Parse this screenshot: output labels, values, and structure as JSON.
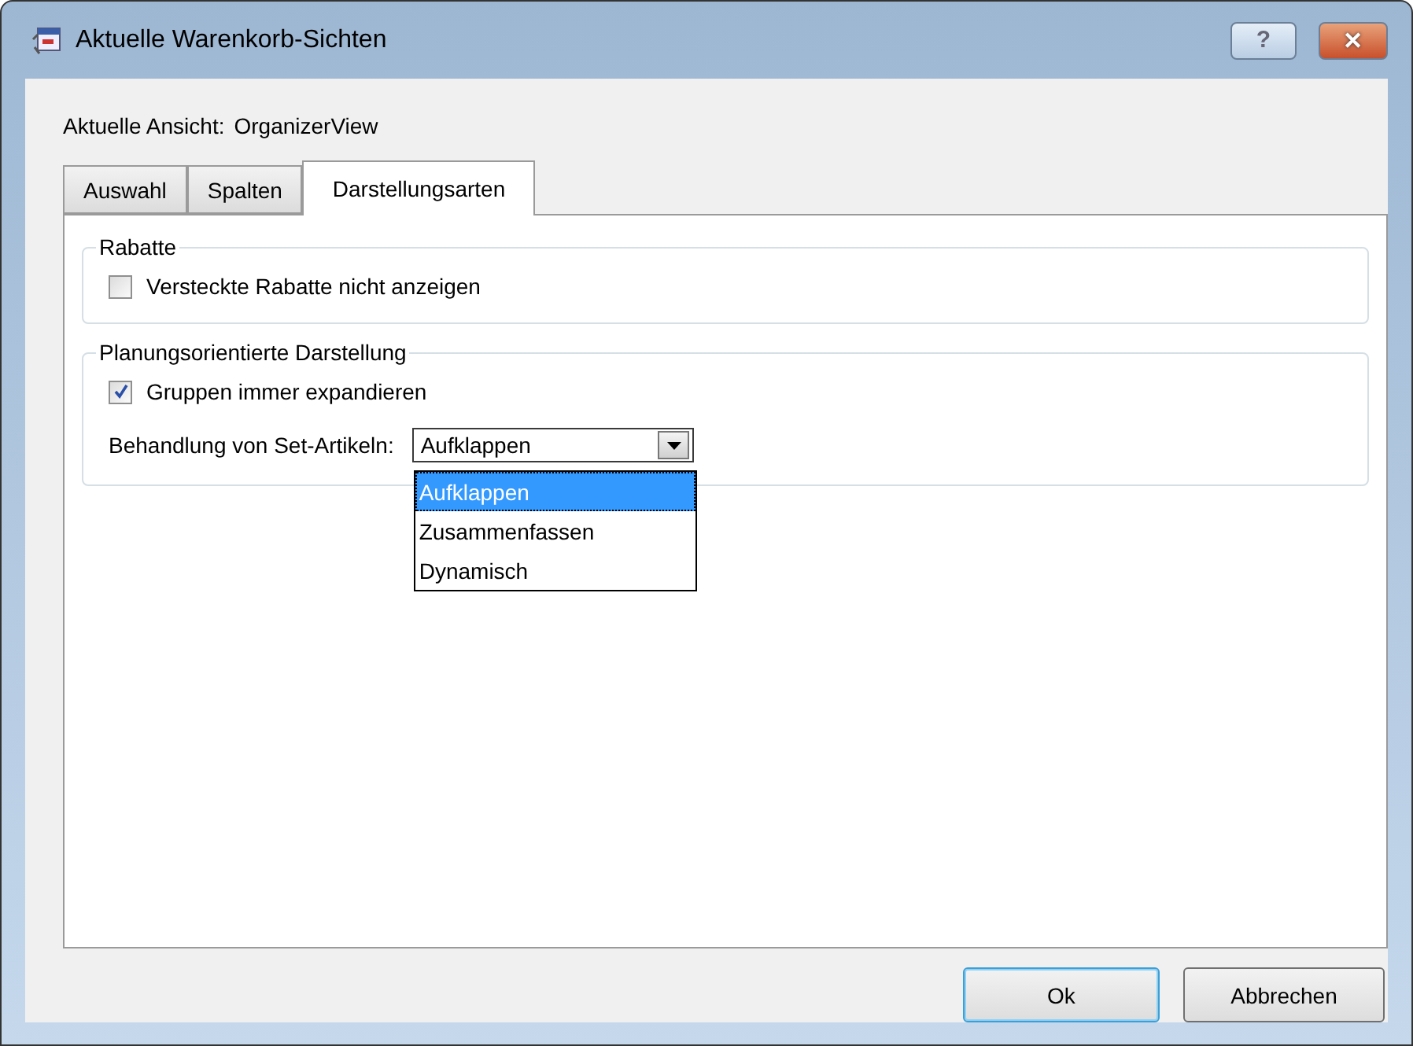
{
  "window": {
    "title": "Aktuelle Warenkorb-Sichten",
    "buttons": [
      {
        "kind": "help",
        "label": "?"
      },
      {
        "kind": "close",
        "label": "✕"
      }
    ]
  },
  "current_view": {
    "label": "Aktuelle Ansicht:",
    "value": "OrganizerView"
  },
  "tabs": [
    {
      "label": "Auswahl",
      "selected": false
    },
    {
      "label": "Spalten",
      "selected": false
    },
    {
      "label": "Darstellungsarten",
      "selected": true
    }
  ],
  "groups": [
    {
      "title": "Rabatte",
      "checkboxes": [
        {
          "label": "Versteckte Rabatte nicht anzeigen",
          "checked": false
        }
      ]
    },
    {
      "title": "Planungsorientierte Darstellung",
      "checkboxes": [
        {
          "label": "Gruppen immer expandieren",
          "checked": true
        }
      ],
      "combo": {
        "label": "Behandlung von Set-Artikeln:",
        "value": "Aufklappen",
        "expanded": true,
        "options": [
          {
            "label": "Aufklappen",
            "selected": true
          },
          {
            "label": "Zusammenfassen",
            "selected": false
          },
          {
            "label": "Dynamisch",
            "selected": false
          }
        ]
      }
    }
  ],
  "buttons": [
    {
      "label": "Ok",
      "default": true
    },
    {
      "label": "Abbrechen",
      "default": false
    }
  ]
}
